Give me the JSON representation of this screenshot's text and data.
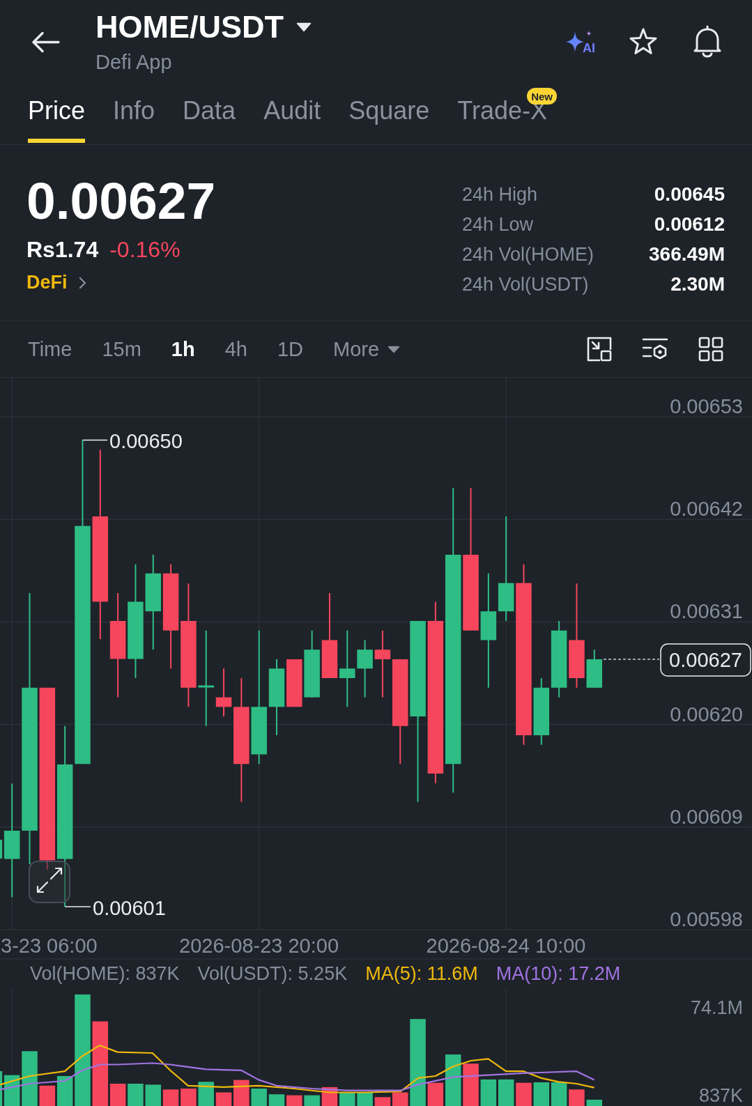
{
  "header": {
    "title": "HOME/USDT",
    "subtitle": "Defi App",
    "ai_label": "AI"
  },
  "tabs": [
    {
      "label": "Price",
      "selected": true
    },
    {
      "label": "Info",
      "selected": false
    },
    {
      "label": "Data",
      "selected": false
    },
    {
      "label": "Audit",
      "selected": false
    },
    {
      "label": "Square",
      "selected": false
    },
    {
      "label": "Trade-X",
      "selected": false,
      "badge": "New"
    }
  ],
  "ticker": {
    "price": "0.00627",
    "fiat_price": "Rs1.74",
    "change": "-0.16%",
    "negative": true,
    "category": "DeFi"
  },
  "stats": [
    {
      "label": "24h High",
      "value": "0.00645"
    },
    {
      "label": "24h Low",
      "value": "0.00612"
    },
    {
      "label": "24h Vol(HOME)",
      "value": "366.49M"
    },
    {
      "label": "24h Vol(USDT)",
      "value": "2.30M"
    }
  ],
  "intervals": [
    {
      "label": "Time",
      "selected": false
    },
    {
      "label": "15m",
      "selected": false
    },
    {
      "label": "1h",
      "selected": true
    },
    {
      "label": "4h",
      "selected": false
    },
    {
      "label": "1D",
      "selected": false
    }
  ],
  "more_menu": {
    "label": "More"
  },
  "chart": {
    "price_axis": [
      "0.00653",
      "0.00642",
      "0.00631",
      "0.00620",
      "0.00609",
      "0.00598"
    ],
    "high_label": "0.00650",
    "low_label": "0.00601",
    "last_price_tag": "0.00627",
    "time_axis": [
      "3-23 06:00",
      "2026-08-23 20:00",
      "2026-08-24 10:00"
    ]
  },
  "volume": {
    "legend": [
      {
        "label": "Vol(HOME): 837K",
        "kind": "volume",
        "color": "#848e9c"
      },
      {
        "label": "Vol(USDT): 5.25K",
        "kind": "volume",
        "color": "#848e9c"
      },
      {
        "label": "MA(5): 11.6M",
        "kind": "average",
        "color": "#f0b90b"
      },
      {
        "label": "MA(10): 17.2M",
        "kind": "average",
        "color": "#a174e3"
      }
    ],
    "axis": [
      "74.1M",
      "837K"
    ]
  }
}
